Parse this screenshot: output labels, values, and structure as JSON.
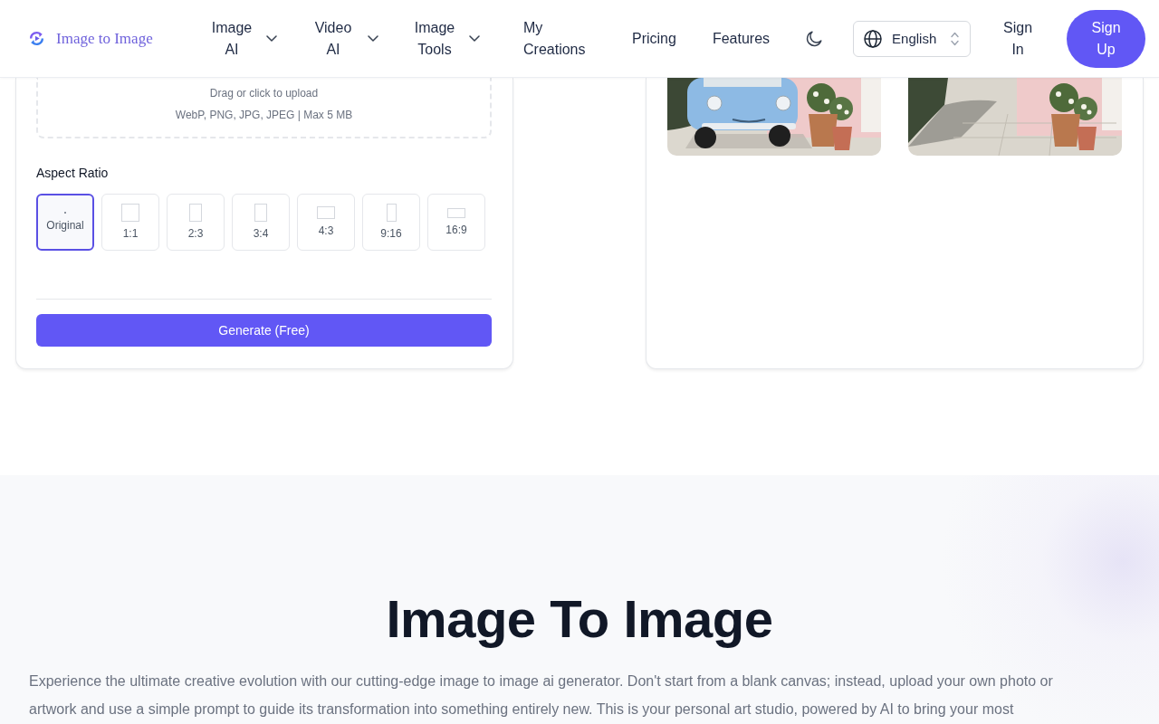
{
  "header": {
    "logo": {
      "text": "Image to Image"
    },
    "nav": [
      {
        "label": "Image AI",
        "kind": "dropdown"
      },
      {
        "label": "Video AI",
        "kind": "dropdown"
      },
      {
        "label": "Image Tools",
        "kind": "dropdown"
      },
      {
        "label": "My Creations",
        "kind": "link"
      },
      {
        "label": "Pricing",
        "kind": "link"
      },
      {
        "label": "Features",
        "kind": "link"
      }
    ],
    "language": {
      "value": "English"
    },
    "sign_in": "Sign In",
    "sign_up": "Sign Up"
  },
  "generator": {
    "upload": {
      "hint": "Drag or click to upload",
      "formats": "WebP, PNG, JPG, JPEG | Max 5 MB"
    },
    "aspect_ratio": {
      "label": "Aspect Ratio",
      "options": [
        {
          "label": "Original",
          "kind": "original",
          "selected": true
        },
        {
          "label": "1:1",
          "kind": "square",
          "selected": false
        },
        {
          "label": "2:3",
          "kind": "portrait",
          "selected": false
        },
        {
          "label": "3:4",
          "kind": "portrait",
          "selected": false
        },
        {
          "label": "4:3",
          "kind": "landscape",
          "selected": false
        },
        {
          "label": "9:16",
          "kind": "tall",
          "selected": false
        },
        {
          "label": "16:9",
          "kind": "wide",
          "selected": false
        }
      ]
    },
    "generate_button": "Generate (Free)"
  },
  "preview": {
    "images": [
      {
        "kind": "car"
      },
      {
        "kind": "street"
      }
    ]
  },
  "intro": {
    "heading": "Image To Image",
    "text": "Experience the ultimate creative evolution with our cutting-edge image to image ai generator. Don't start from a blank canvas; instead, upload your own photo or artwork and use a simple prompt to guide its transformation into something entirely new. This is your personal art studio, powered by AI to bring your most"
  }
}
